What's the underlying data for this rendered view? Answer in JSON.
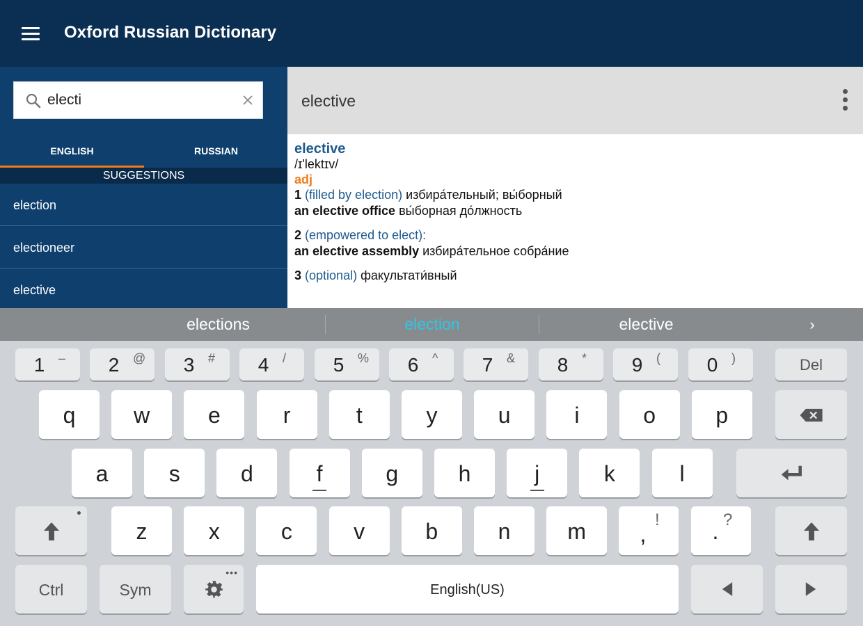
{
  "app": {
    "title": "Oxford Russian Dictionary"
  },
  "search": {
    "value": "electi"
  },
  "tabs": [
    {
      "label": "ENGLISH"
    },
    {
      "label": "RUSSIAN"
    }
  ],
  "suggestions": {
    "heading": "SUGGESTIONS",
    "items": [
      {
        "label": "election"
      },
      {
        "label": "electioneer"
      },
      {
        "label": "elective"
      }
    ]
  },
  "entry": {
    "header_word": "elective",
    "headword": "elective",
    "pronunciation": "/ɪ'lektɪv/",
    "pos": "adj",
    "senses": [
      {
        "num": "1",
        "gloss": "(filled by election)",
        "translation": " избира́тельный; вы́борный",
        "phrase": "an elective office",
        "phrase_translation": " вы́борная до́лжность"
      },
      {
        "num": "2",
        "gloss": "(empowered to elect):",
        "translation": "",
        "phrase": "an elective assembly",
        "phrase_translation": " избира́тельное собра́ние"
      },
      {
        "num": "3",
        "gloss": "(optional)",
        "translation": " факультати́вный",
        "phrase": "",
        "phrase_translation": ""
      }
    ]
  },
  "keyboard": {
    "candidates": [
      "elections",
      "election",
      "elective"
    ],
    "candidate_highlight_color": "#2fc6e8",
    "number_row": [
      {
        "main": "1",
        "alt": "–"
      },
      {
        "main": "2",
        "alt": "@"
      },
      {
        "main": "3",
        "alt": "#"
      },
      {
        "main": "4",
        "alt": "/"
      },
      {
        "main": "5",
        "alt": "%"
      },
      {
        "main": "6",
        "alt": "^"
      },
      {
        "main": "7",
        "alt": "&"
      },
      {
        "main": "8",
        "alt": "*"
      },
      {
        "main": "9",
        "alt": "("
      },
      {
        "main": "0",
        "alt": ")"
      }
    ],
    "del_label": "Del",
    "row1": [
      "q",
      "w",
      "e",
      "r",
      "t",
      "y",
      "u",
      "i",
      "o",
      "p"
    ],
    "row2": [
      "a",
      "s",
      "d",
      "f",
      "g",
      "h",
      "j",
      "k",
      "l"
    ],
    "row3": [
      "z",
      "x",
      "c",
      "v",
      "b",
      "n",
      "m"
    ],
    "comma": {
      "main": ",",
      "alt": "!"
    },
    "period": {
      "main": ".",
      "alt": "?"
    },
    "ctrl_label": "Ctrl",
    "sym_label": "Sym",
    "space_label": "English(US)"
  },
  "colors": {
    "appbar": "#0b2e53",
    "panel": "#0e3f6d",
    "accent": "#f07b1c",
    "link": "#1e5a8e"
  }
}
